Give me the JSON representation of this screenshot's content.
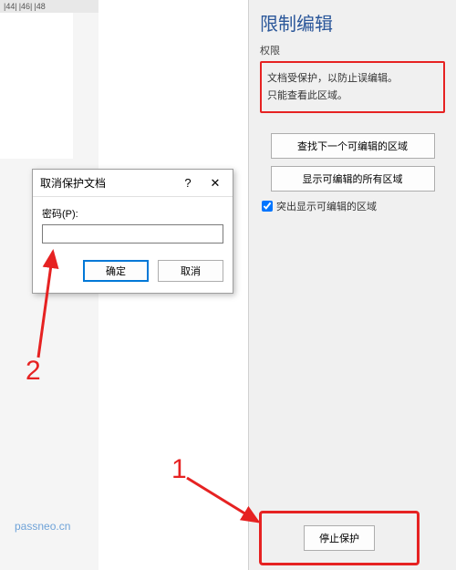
{
  "ruler": {
    "m1": "|44|",
    "m2": "|46|",
    "m3": "|48"
  },
  "panel": {
    "title": "限制编辑",
    "perm_label": "权限",
    "perm_line1": "文档受保护，以防止误编辑。",
    "perm_line2": "只能查看此区域。",
    "btn_find": "查找下一个可编辑的区域",
    "btn_show": "显示可编辑的所有区域",
    "chk_highlight": "突出显示可编辑的区域"
  },
  "stop": {
    "label": "停止保护"
  },
  "dialog": {
    "title": "取消保护文档",
    "help": "?",
    "close": "✕",
    "pw_label": "密码(P):",
    "ok": "确定",
    "cancel": "取消"
  },
  "anno": {
    "n1": "1",
    "n2": "2"
  },
  "watermark": "passneo.cn"
}
